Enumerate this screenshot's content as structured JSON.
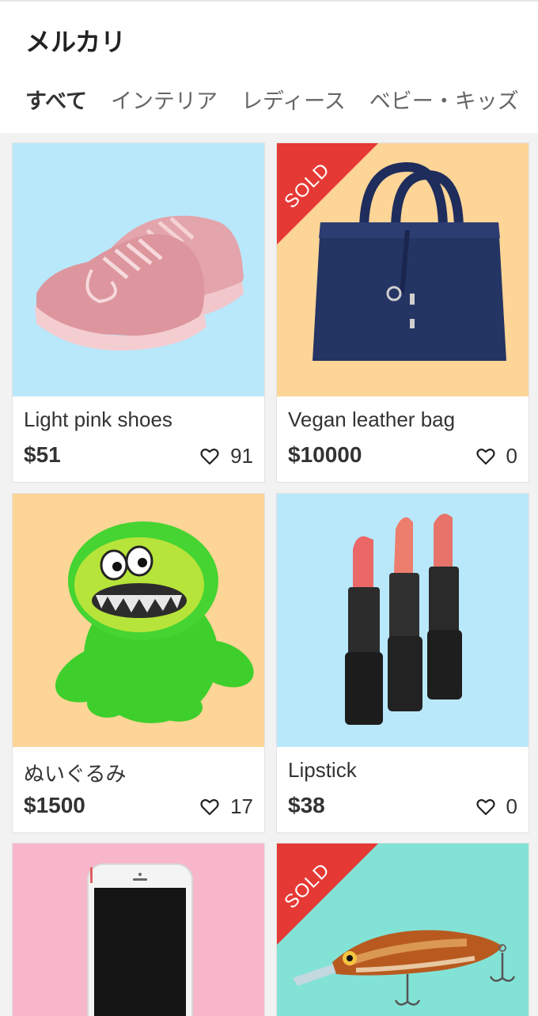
{
  "header": {
    "title": "メルカリ"
  },
  "tabs": [
    {
      "label": "すべて",
      "active": true
    },
    {
      "label": "インテリア",
      "active": false
    },
    {
      "label": "レディース",
      "active": false
    },
    {
      "label": "ベビー・キッズ",
      "active": false
    }
  ],
  "items": [
    {
      "name": "Light pink shoes",
      "price": "$51",
      "likes": "91",
      "sold": false,
      "bg": "#b9e8fb",
      "image": "pink-sneakers"
    },
    {
      "name": "Vegan leather bag",
      "price": "$10000",
      "likes": "0",
      "sold": true,
      "sold_label": "SOLD",
      "bg": "#fdd597",
      "image": "navy-handbag"
    },
    {
      "name": "ぬいぐるみ",
      "price": "$1500",
      "likes": "17",
      "sold": false,
      "bg": "#fdd597",
      "image": "green-plush-toy"
    },
    {
      "name": "Lipstick",
      "price": "$38",
      "likes": "0",
      "sold": false,
      "bg": "#b9e8fb",
      "image": "lipsticks"
    },
    {
      "sold": false,
      "bg": "#f7b6c9",
      "image": "smartphone"
    },
    {
      "sold": true,
      "sold_label": "SOLD",
      "bg": "#83e2d6",
      "image": "fishing-lure"
    }
  ],
  "colors": {
    "sold_ribbon": "#e53935",
    "background": "#f2f2f2"
  }
}
